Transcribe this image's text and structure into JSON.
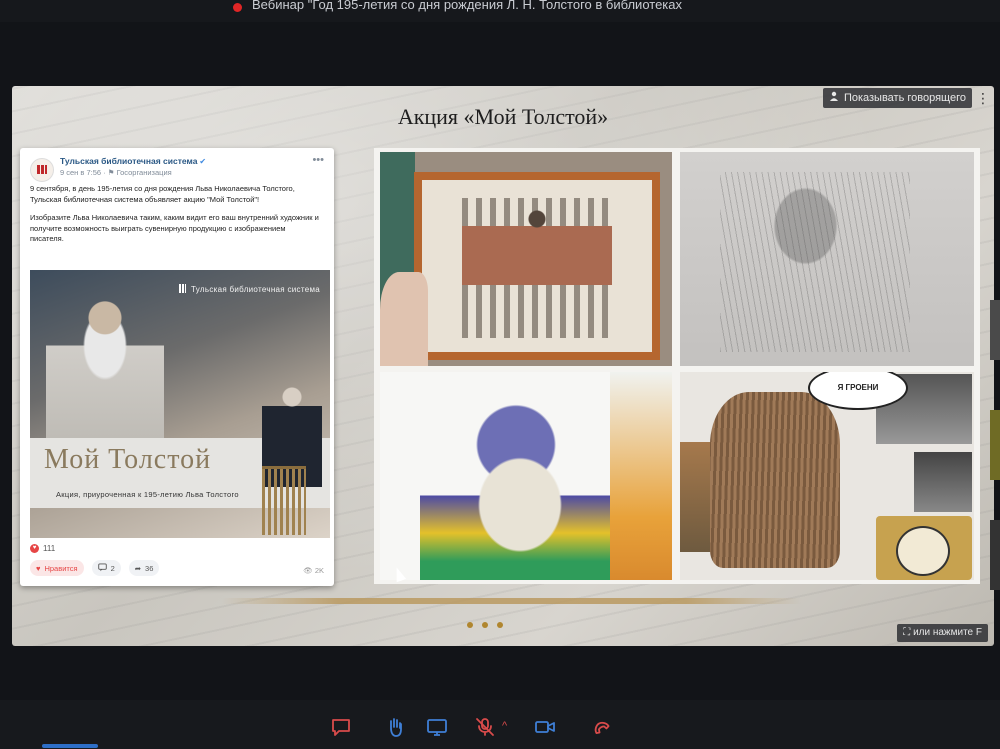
{
  "header": {
    "webinar_title": "Вебинар \"Год 195-летия со дня рождения Л. Н. Толстого в библиотеках"
  },
  "slide": {
    "title": "Акция «Мой Толстой»",
    "speaker_button_label": "Показывать говорящего",
    "hint_label": "или нажмите F"
  },
  "post": {
    "author": "Тульская библиотечная система",
    "date": "9 сен в 7:56",
    "meta_tag": "Госорганизация",
    "paragraph_1": "9 сентября, в день 195-летия со дня рождения Льва Николаевича Толстого, Тульская библиотечная система объявляет акцию \"Мой Толстой\"!",
    "paragraph_2": "Изобразите Льва Николаевича таким, каким видит его ваш внутренний художник и получите возможность выиграть сувенирную продукцию с изображением писателя.",
    "image": {
      "brand": "Тульская библиотечная система",
      "title": "Мой Толстой",
      "subtitle": "Акция, приуроченная к 195-летию Льва Толстого"
    },
    "reactions_count": "111",
    "like_label": "Нравится",
    "comments_count": "2",
    "shares_count": "36",
    "views_count": "2K"
  },
  "gallery": {
    "bubble_text": "Я ГРОЕНИ"
  },
  "colors": {
    "accent_gold": "#b0862f",
    "vk_blue": "#2a5885",
    "like_red": "#e64646",
    "control_red": "#d94b4b"
  },
  "controls": {
    "icons": [
      "chat-icon",
      "raise-hand-icon",
      "screen-share-icon",
      "mic-muted-icon",
      "camera-icon",
      "leave-call-icon"
    ]
  }
}
